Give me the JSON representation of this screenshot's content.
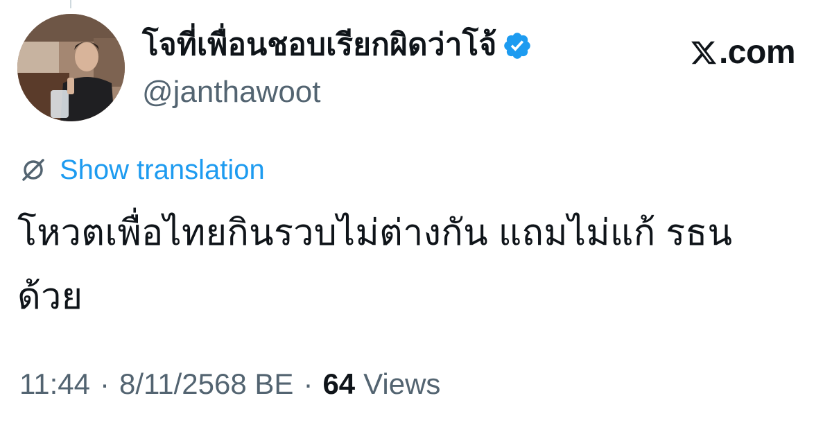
{
  "user": {
    "display_name": "โจที่เพื่อนชอบเรียกผิดว่าโจ้",
    "handle": "@janthawoot",
    "verified": true,
    "verified_badge_color": "#1d9bf0"
  },
  "brand": {
    "logo_icon": "x-logo-icon",
    "text": ".com"
  },
  "translation": {
    "icon": "globe-icon",
    "label": "Show translation",
    "link_color": "#1d9bf0"
  },
  "tweet": {
    "text": "โหวตเพื่อไทยกินรวบไม่ต่างกัน แถมไม่แก้ รธน ด้วย"
  },
  "meta": {
    "time": "11:44",
    "separator": "·",
    "date": "8/11/2568 BE",
    "views_count": "64",
    "views_label": "Views"
  }
}
